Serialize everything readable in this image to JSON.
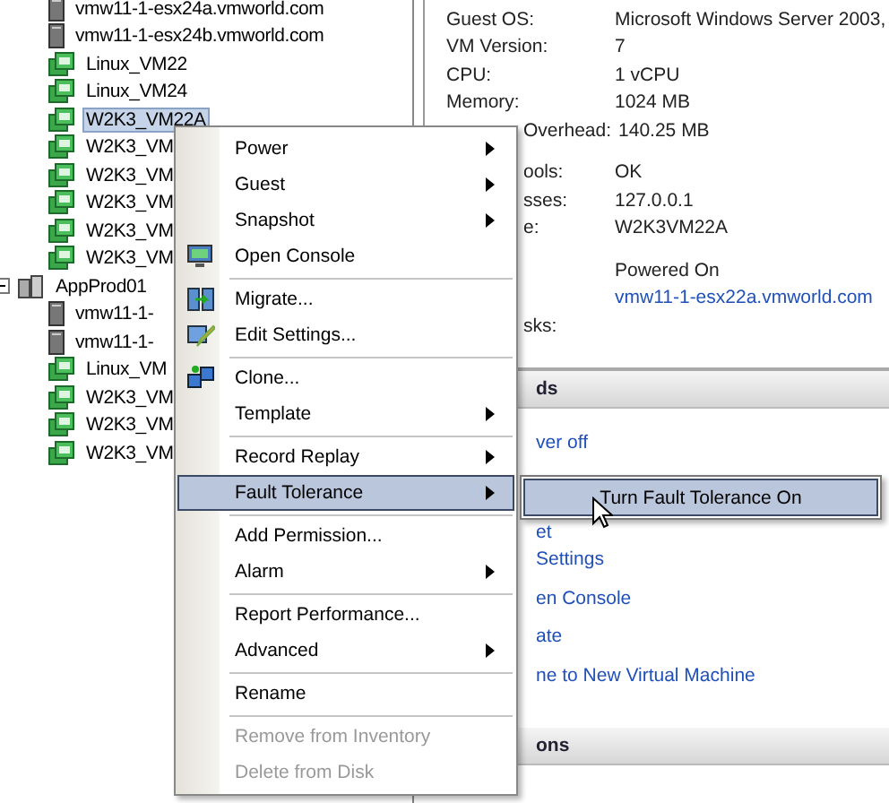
{
  "tree": {
    "continued_children": [
      {
        "label": "vmw11-1-esx24a.vmworld.com",
        "kind": "host",
        "selected": false
      },
      {
        "label": "vmw11-1-esx24b.vmworld.com",
        "kind": "host",
        "selected": false
      },
      {
        "label": "Linux_VM22",
        "kind": "vm",
        "selected": false
      },
      {
        "label": "Linux_VM24",
        "kind": "vm",
        "selected": false
      },
      {
        "label": "W2K3_VM22A",
        "kind": "vm",
        "selected": true
      },
      {
        "label": "W2K3_VM",
        "kind": "vm",
        "selected": false
      },
      {
        "label": "W2K3_VM",
        "kind": "vm",
        "selected": false
      },
      {
        "label": "W2K3_VM",
        "kind": "vm",
        "selected": false
      },
      {
        "label": "W2K3_VM",
        "kind": "vm",
        "selected": false
      },
      {
        "label": "W2K3_VM",
        "kind": "vm",
        "selected": false
      }
    ],
    "items": [
      {
        "label": "AppProd01",
        "kind": "cluster",
        "selected": false,
        "expanded": true,
        "children": [
          {
            "label": "vmw11-1-",
            "kind": "host",
            "selected": false
          },
          {
            "label": "vmw11-1-",
            "kind": "host",
            "selected": false
          },
          {
            "label": "Linux_VM",
            "kind": "vm",
            "selected": false
          },
          {
            "label": "W2K3_VM",
            "kind": "vm",
            "selected": false
          },
          {
            "label": "W2K3_VM",
            "kind": "vm",
            "selected": false
          },
          {
            "label": "W2K3_VM",
            "kind": "vm",
            "selected": false
          }
        ]
      }
    ]
  },
  "details": {
    "groups": [
      [
        {
          "label": "Guest OS:",
          "value": "Microsoft Windows Server 2003,",
          "covered": false
        },
        {
          "label": "VM Version:",
          "value": "7",
          "covered": false
        },
        {
          "label": "CPU:",
          "value": "1 vCPU",
          "covered": false
        },
        {
          "label": "Memory:",
          "value": "1024 MB",
          "covered": false
        },
        {
          "label": "Overhead:",
          "value": "140.25 MB",
          "covered": true
        }
      ],
      [
        {
          "label": "ools:",
          "value": "OK",
          "covered": true
        },
        {
          "label": "sses:",
          "value": "127.0.0.1",
          "covered": true
        },
        {
          "label": "e:",
          "value": "W2K3VM22A",
          "covered": true
        }
      ],
      [
        {
          "value": "Powered On",
          "link": false
        },
        {
          "value": "vmw11-1-esx22a.vmworld.com",
          "link": true
        },
        {
          "label": "sks:",
          "covered": true
        }
      ]
    ]
  },
  "commands": {
    "title": "ds",
    "links": [
      "ver off",
      "et",
      "Settings",
      "en Console",
      "ate",
      "ne to New Virtual Machine"
    ]
  },
  "annotations_header": {
    "title": "ons"
  },
  "context_menu": {
    "items": [
      {
        "kind": "item",
        "label": "Power",
        "submenu": true,
        "has_icon": false,
        "selected": false,
        "disabled": false
      },
      {
        "kind": "item",
        "label": "Guest",
        "submenu": true,
        "has_icon": false,
        "selected": false,
        "disabled": false
      },
      {
        "kind": "item",
        "label": "Snapshot",
        "submenu": true,
        "has_icon": false,
        "selected": false,
        "disabled": false
      },
      {
        "kind": "item",
        "label": "Open Console",
        "submenu": false,
        "has_icon": true,
        "selected": false,
        "disabled": false
      },
      {
        "kind": "separator"
      },
      {
        "kind": "item",
        "label": "Migrate...",
        "submenu": false,
        "has_icon": true,
        "selected": false,
        "disabled": false
      },
      {
        "kind": "item",
        "label": "Edit Settings...",
        "submenu": false,
        "has_icon": true,
        "selected": false,
        "disabled": false
      },
      {
        "kind": "separator"
      },
      {
        "kind": "item",
        "label": "Clone...",
        "submenu": false,
        "has_icon": true,
        "selected": false,
        "disabled": false
      },
      {
        "kind": "item",
        "label": "Template",
        "submenu": true,
        "has_icon": false,
        "selected": false,
        "disabled": false
      },
      {
        "kind": "separator"
      },
      {
        "kind": "item",
        "label": "Record Replay",
        "submenu": true,
        "has_icon": false,
        "selected": false,
        "disabled": false
      },
      {
        "kind": "item",
        "label": "Fault Tolerance",
        "submenu": true,
        "has_icon": false,
        "selected": true,
        "disabled": false
      },
      {
        "kind": "separator"
      },
      {
        "kind": "item",
        "label": "Add Permission...",
        "submenu": false,
        "has_icon": false,
        "selected": false,
        "disabled": false
      },
      {
        "kind": "item",
        "label": "Alarm",
        "submenu": true,
        "has_icon": false,
        "selected": false,
        "disabled": false
      },
      {
        "kind": "separator"
      },
      {
        "kind": "item",
        "label": "Report Performance...",
        "submenu": false,
        "has_icon": false,
        "selected": false,
        "disabled": false
      },
      {
        "kind": "item",
        "label": "Advanced",
        "submenu": true,
        "has_icon": false,
        "selected": false,
        "disabled": false
      },
      {
        "kind": "separator"
      },
      {
        "kind": "item",
        "label": "Rename",
        "submenu": false,
        "has_icon": false,
        "selected": false,
        "disabled": false
      },
      {
        "kind": "separator"
      },
      {
        "kind": "item",
        "label": "Remove from Inventory",
        "submenu": false,
        "has_icon": false,
        "selected": false,
        "disabled": true
      },
      {
        "kind": "item",
        "label": "Delete from Disk",
        "submenu": false,
        "has_icon": false,
        "selected": false,
        "disabled": true
      }
    ]
  },
  "submenu": {
    "items": [
      {
        "label": "Turn Fault Tolerance On",
        "selected": true
      }
    ]
  }
}
